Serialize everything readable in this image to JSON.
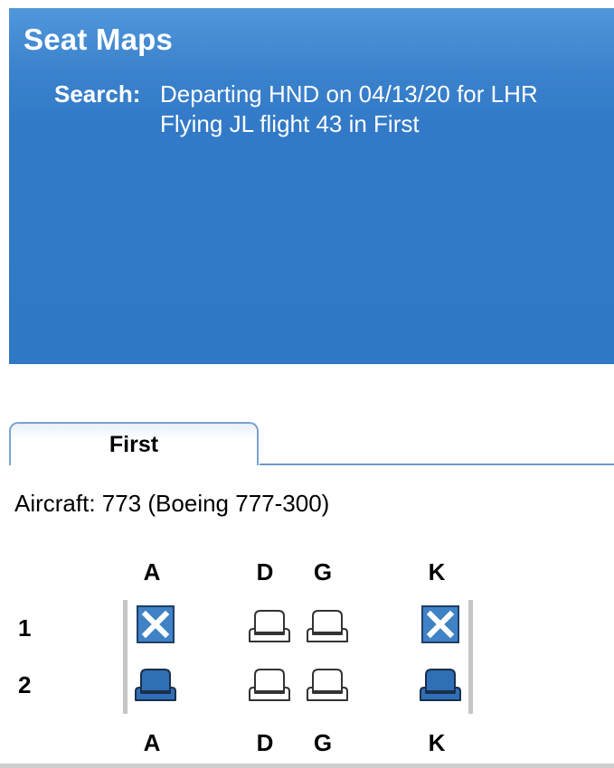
{
  "header": {
    "title": "Seat Maps",
    "search_label": "Search:",
    "search_line1": "Departing HND on 04/13/20 for LHR",
    "search_line2": "Flying JL flight 43 in First"
  },
  "cabin_tabs": [
    {
      "label": "First",
      "active": true
    }
  ],
  "aircraft_info": "Aircraft: 773 (Boeing 777-300)",
  "seat_map": {
    "columns": [
      "A",
      "D",
      "G",
      "K"
    ],
    "rows": [
      {
        "label": "1",
        "seats": [
          {
            "column": "A",
            "status": "unavailable",
            "icon": "x-icon"
          },
          {
            "column": "D",
            "status": "available",
            "icon": "seat-icon"
          },
          {
            "column": "G",
            "status": "available",
            "icon": "seat-icon"
          },
          {
            "column": "K",
            "status": "unavailable",
            "icon": "x-icon"
          }
        ]
      },
      {
        "label": "2",
        "seats": [
          {
            "column": "A",
            "status": "occupied",
            "icon": "seat-icon"
          },
          {
            "column": "D",
            "status": "available",
            "icon": "seat-icon"
          },
          {
            "column": "G",
            "status": "available",
            "icon": "seat-icon"
          },
          {
            "column": "K",
            "status": "occupied",
            "icon": "seat-icon"
          }
        ]
      }
    ]
  },
  "colors": {
    "header_blue": "#3179c7",
    "seat_occupied": "#2f6fb6",
    "seat_available": "#ffffff",
    "seat_outline": "#333333",
    "blocked_blue": "#3f82c6"
  }
}
